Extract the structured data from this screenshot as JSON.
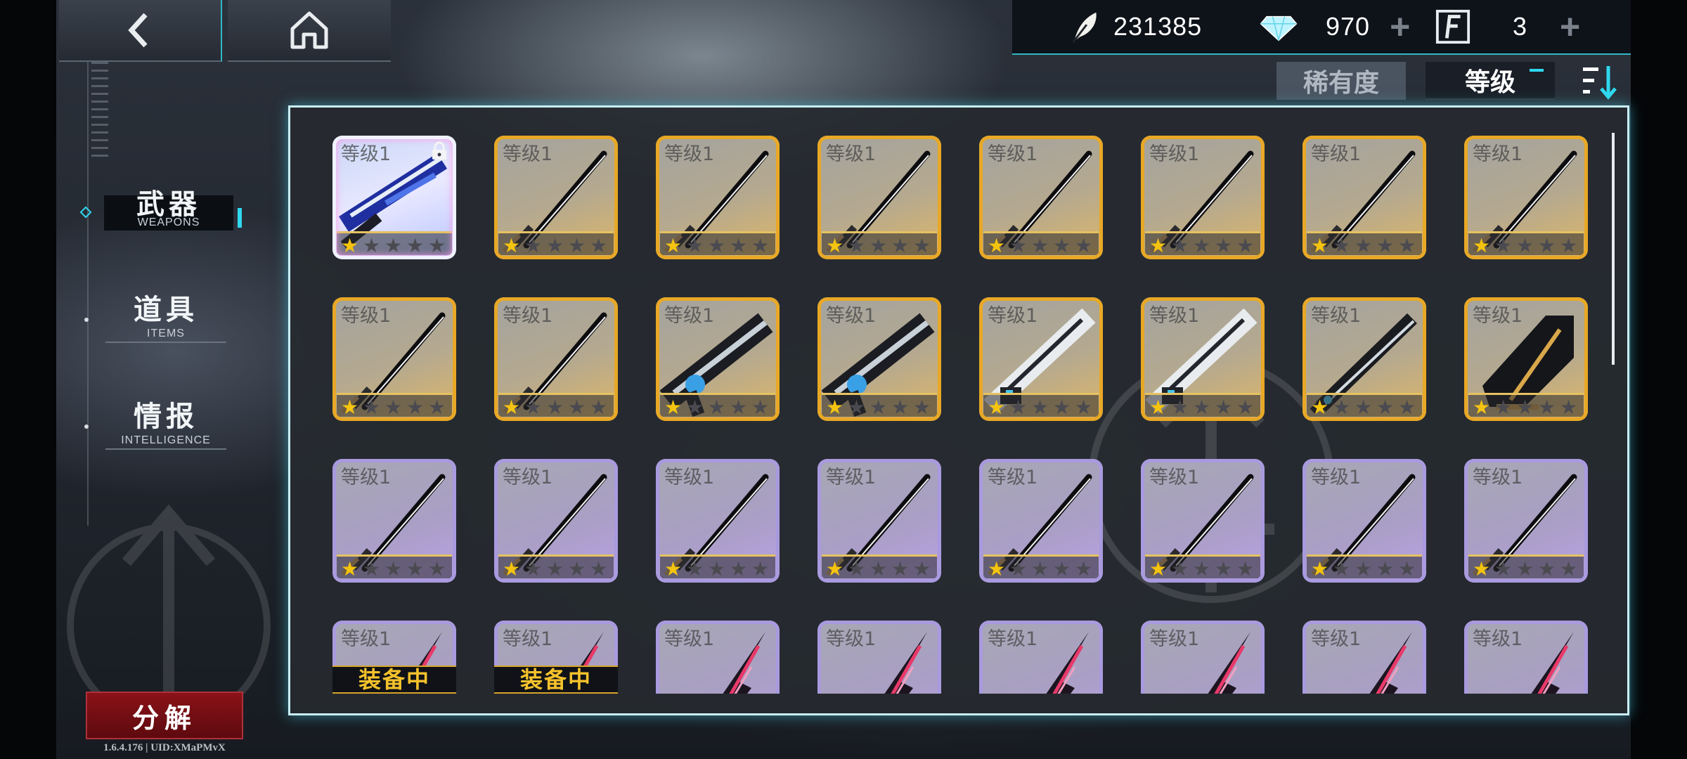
{
  "nav": {
    "back_icon": "chevron-left-icon",
    "home_icon": "home-icon"
  },
  "currencies": [
    {
      "icon": "feather-icon",
      "value": "231385",
      "plus": false
    },
    {
      "icon": "diamond-icon",
      "value": "970",
      "plus": true
    },
    {
      "icon": "ticket-card-icon",
      "value": "3",
      "plus": true
    }
  ],
  "sort": {
    "rarity_label": "稀有度",
    "level_label": "等级",
    "order_icon": "sort-descending-icon"
  },
  "sidebar": {
    "items": [
      {
        "zh": "武器",
        "en": "WEAPONS",
        "active": true
      },
      {
        "zh": "道具",
        "en": "ITEMS",
        "active": false
      },
      {
        "zh": "情报",
        "en": "INTELLIGENCE",
        "active": false
      }
    ]
  },
  "decompose_label": "分解",
  "version_text": "1.6.4.176 | UID:XMaPMvX",
  "inventory": {
    "rows": [
      [
        {
          "level": "等级1",
          "rarity": "rainbow",
          "weapon": "blue-blade",
          "stars": 1,
          "locked": true
        },
        {
          "level": "等级1",
          "rarity": "gold",
          "weapon": "katana",
          "stars": 1
        },
        {
          "level": "等级1",
          "rarity": "gold",
          "weapon": "katana",
          "stars": 1
        },
        {
          "level": "等级1",
          "rarity": "gold",
          "weapon": "katana",
          "stars": 1
        },
        {
          "level": "等级1",
          "rarity": "gold",
          "weapon": "katana",
          "stars": 1
        },
        {
          "level": "等级1",
          "rarity": "gold",
          "weapon": "katana",
          "stars": 1
        },
        {
          "level": "等级1",
          "rarity": "gold",
          "weapon": "katana",
          "stars": 1
        },
        {
          "level": "等级1",
          "rarity": "gold",
          "weapon": "katana",
          "stars": 1
        }
      ],
      [
        {
          "level": "等级1",
          "rarity": "gold",
          "weapon": "katana",
          "stars": 1
        },
        {
          "level": "等级1",
          "rarity": "gold",
          "weapon": "katana",
          "stars": 1
        },
        {
          "level": "等级1",
          "rarity": "gold",
          "weapon": "gun",
          "stars": 1
        },
        {
          "level": "等级1",
          "rarity": "gold",
          "weapon": "gun",
          "stars": 1
        },
        {
          "level": "等级1",
          "rarity": "gold",
          "weapon": "silver-blade",
          "stars": 1
        },
        {
          "level": "等级1",
          "rarity": "gold",
          "weapon": "silver-blade",
          "stars": 1
        },
        {
          "level": "等级1",
          "rarity": "gold",
          "weapon": "greatsword",
          "stars": 1
        },
        {
          "level": "等级1",
          "rarity": "gold",
          "weapon": "gauntlet",
          "stars": 1
        }
      ],
      [
        {
          "level": "等级1",
          "rarity": "purple",
          "weapon": "katana",
          "stars": 1
        },
        {
          "level": "等级1",
          "rarity": "purple",
          "weapon": "katana",
          "stars": 1
        },
        {
          "level": "等级1",
          "rarity": "purple",
          "weapon": "katana",
          "stars": 1
        },
        {
          "level": "等级1",
          "rarity": "purple",
          "weapon": "katana",
          "stars": 1
        },
        {
          "level": "等级1",
          "rarity": "purple",
          "weapon": "katana",
          "stars": 1
        },
        {
          "level": "等级1",
          "rarity": "purple",
          "weapon": "katana",
          "stars": 1
        },
        {
          "level": "等级1",
          "rarity": "purple",
          "weapon": "katana",
          "stars": 1
        },
        {
          "level": "等级1",
          "rarity": "purple",
          "weapon": "katana",
          "stars": 1
        }
      ],
      [
        {
          "level": "等级1",
          "rarity": "purple",
          "weapon": "spear",
          "equipped": "装备中"
        },
        {
          "level": "等级1",
          "rarity": "purple",
          "weapon": "spear",
          "equipped": "装备中"
        },
        {
          "level": "等级1",
          "rarity": "purple",
          "weapon": "spear"
        },
        {
          "level": "等级1",
          "rarity": "purple",
          "weapon": "spear"
        },
        {
          "level": "等级1",
          "rarity": "purple",
          "weapon": "spear"
        },
        {
          "level": "等级1",
          "rarity": "purple",
          "weapon": "spear"
        },
        {
          "level": "等级1",
          "rarity": "purple",
          "weapon": "spear"
        },
        {
          "level": "等级1",
          "rarity": "purple",
          "weapon": "spear"
        }
      ]
    ]
  },
  "colors": {
    "accent_cyan": "#2fd8ef",
    "gold_frame": "#e8a826",
    "purple_frame": "#a99adf",
    "decompose_red": "#8a1218",
    "star_gold": "#f4c40f"
  }
}
